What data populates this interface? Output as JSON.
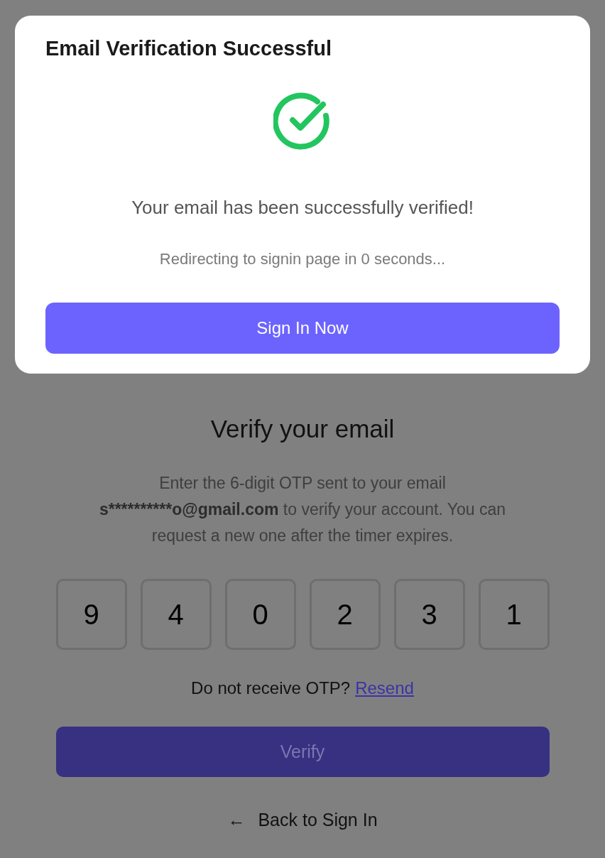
{
  "modal": {
    "title": "Email Verification Successful",
    "message": "Your email has been successfully verified!",
    "redirect": "Redirecting to signin page in 0 seconds...",
    "button": "Sign In Now"
  },
  "verify": {
    "title": "Verify your email",
    "description": {
      "before": "Enter the 6-digit OTP sent to your email",
      "email": "s**********o@gmail.com",
      "after": "to verify your account. You can request a new one after the timer expires."
    },
    "otp": [
      "9",
      "4",
      "0",
      "2",
      "3",
      "1"
    ],
    "resend_prompt": "Do not receive OTP?",
    "resend_link": "Resend",
    "verify_button": {
      "label": "Verify",
      "disabled": true
    },
    "back_arrow": "←",
    "back_link": "Back to Sign In"
  }
}
